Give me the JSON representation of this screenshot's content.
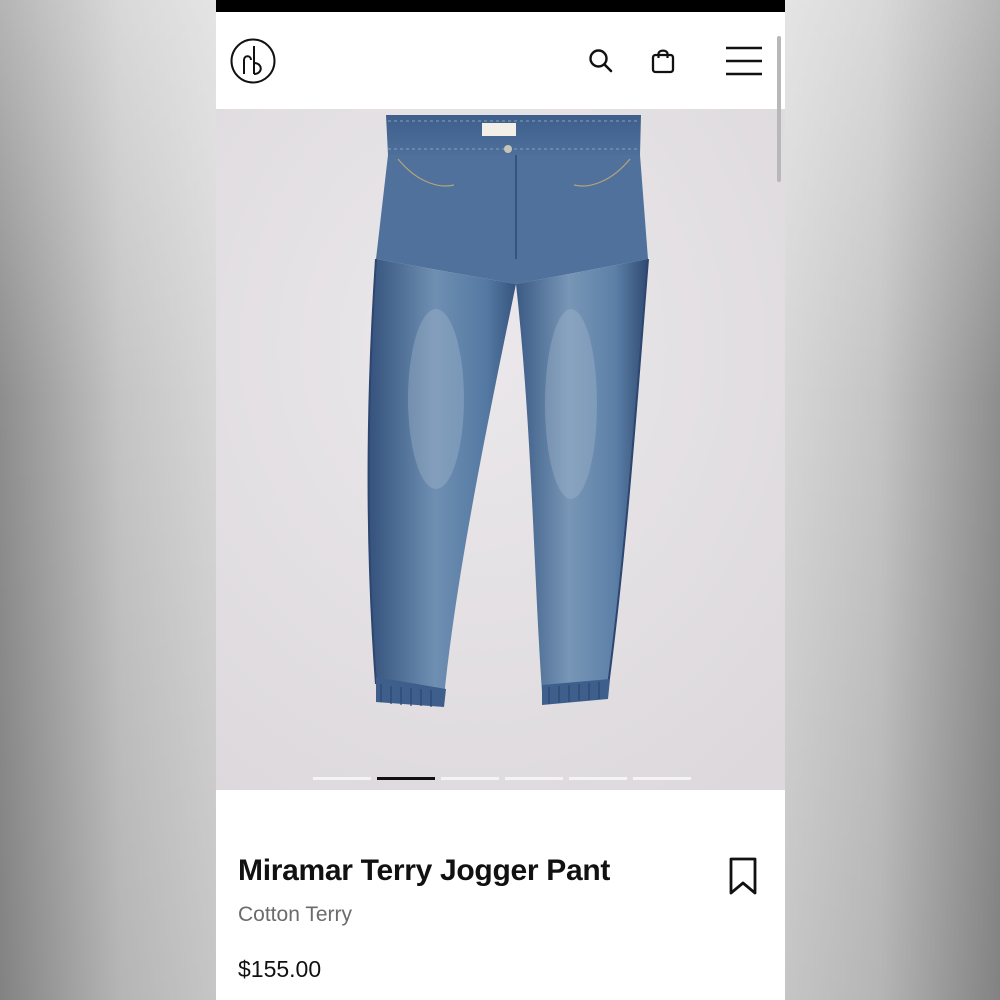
{
  "header": {
    "logo": "rb",
    "icons": {
      "search": "search-icon",
      "bag": "shopping-bag-icon",
      "menu": "hamburger-menu-icon"
    }
  },
  "gallery": {
    "image": "denim-jogger-pant-photo",
    "slide_count": 6,
    "active_slide": 2
  },
  "product": {
    "title": "Miramar Terry Jogger Pant",
    "subtitle": "Cotton Terry",
    "price": "$155.00",
    "bookmark_icon": "bookmark-icon"
  },
  "colors": {
    "text": "#111111",
    "subtitle": "#6b6b6b",
    "gallery_bg": "#e3dfe3",
    "denim": "#4b6d9a"
  }
}
